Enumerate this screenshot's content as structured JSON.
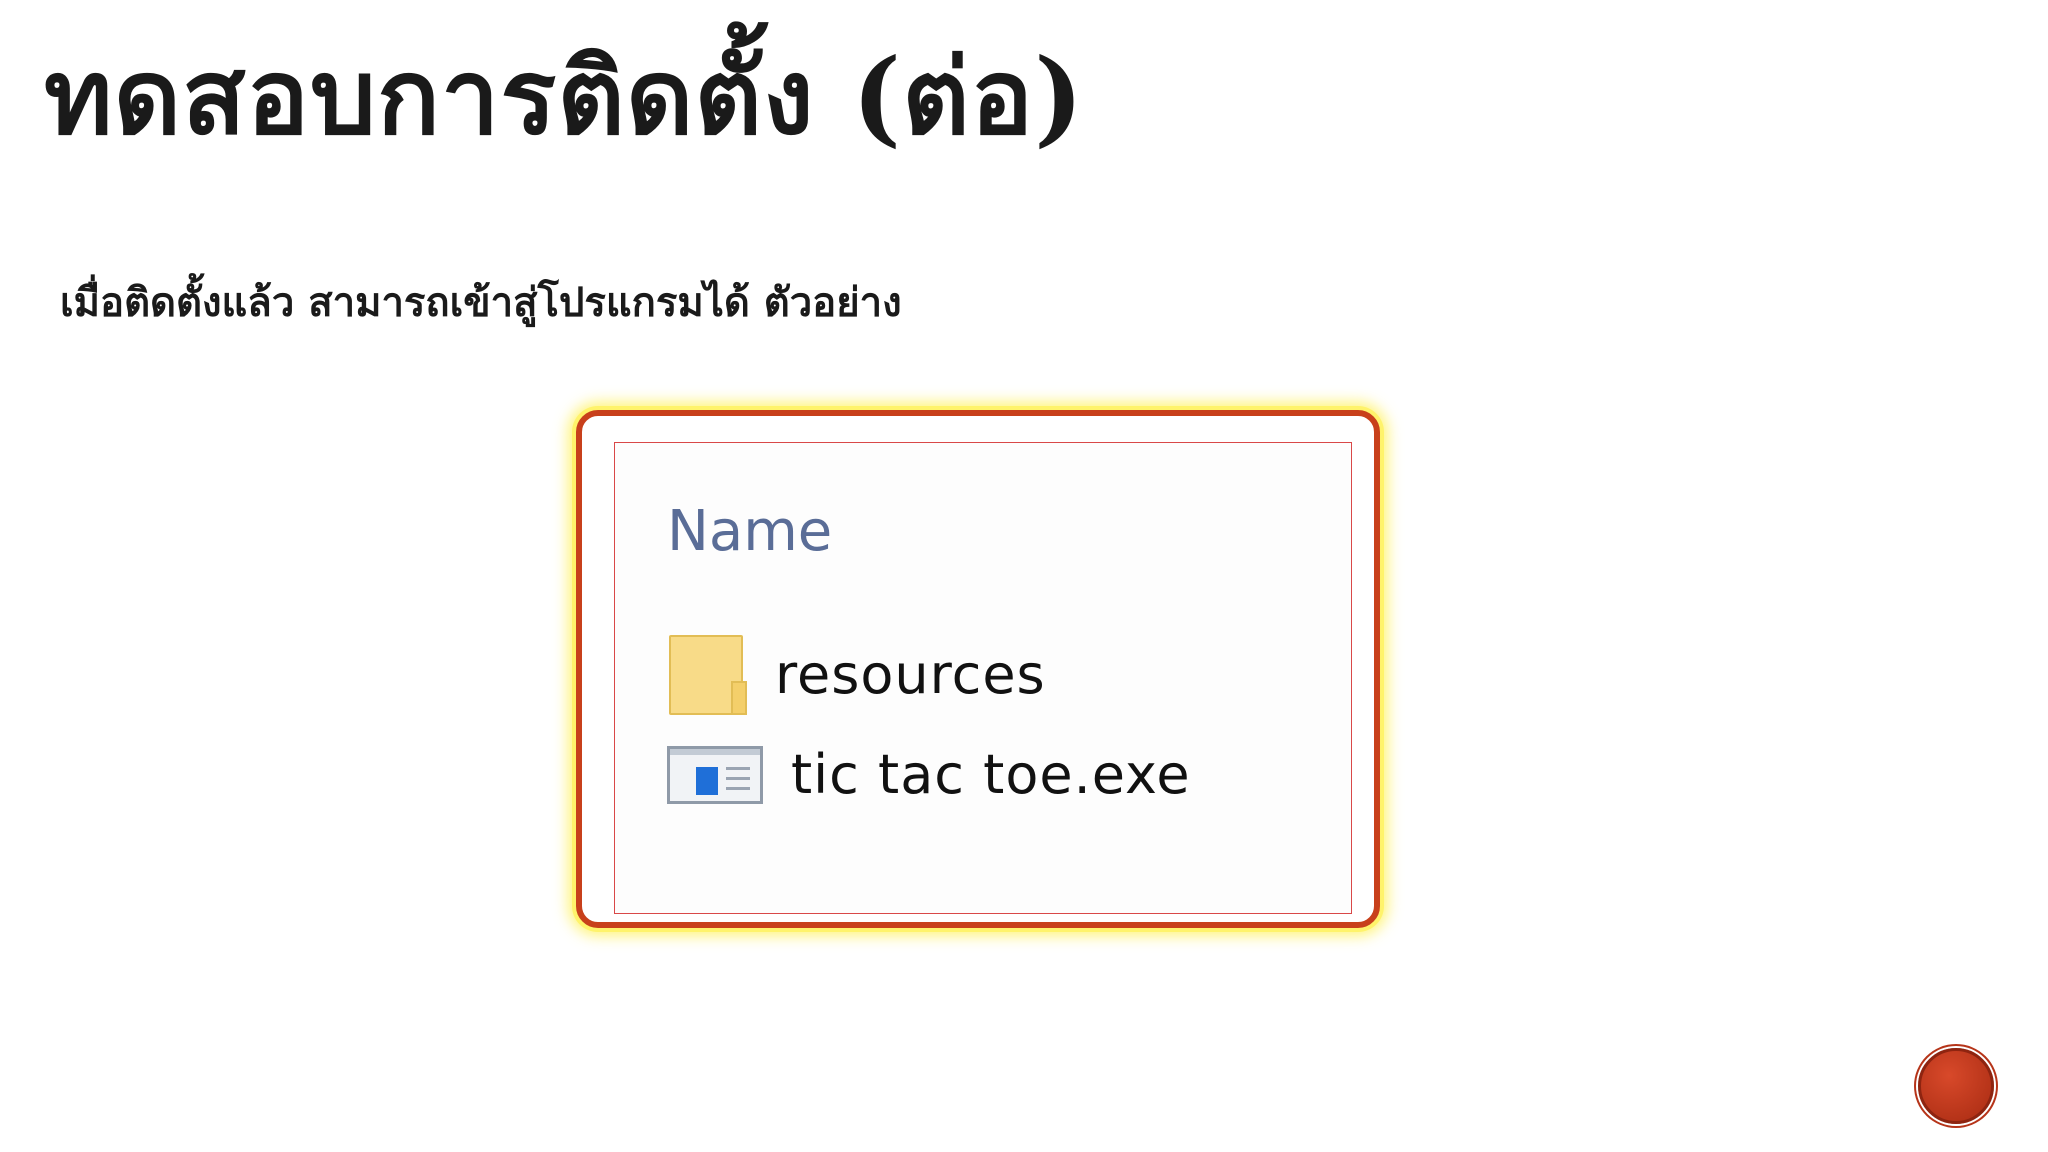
{
  "slide": {
    "title": "ทดสอบการติดตั้ง (ต่อ)",
    "body_text": "เมื่อติดตั้งแล้ว สามารถเข้าสู่โปรแกรมได้ ตัวอย่าง"
  },
  "screenshot": {
    "column_header": "Name",
    "files": [
      {
        "name": "resources",
        "icon": "folder-icon"
      },
      {
        "name": "tic tac toe.exe",
        "icon": "application-icon"
      }
    ],
    "frame_color": "#c8401b",
    "glow_color": "#fff36b"
  },
  "footer": {
    "badge_color": "#c0391a"
  }
}
